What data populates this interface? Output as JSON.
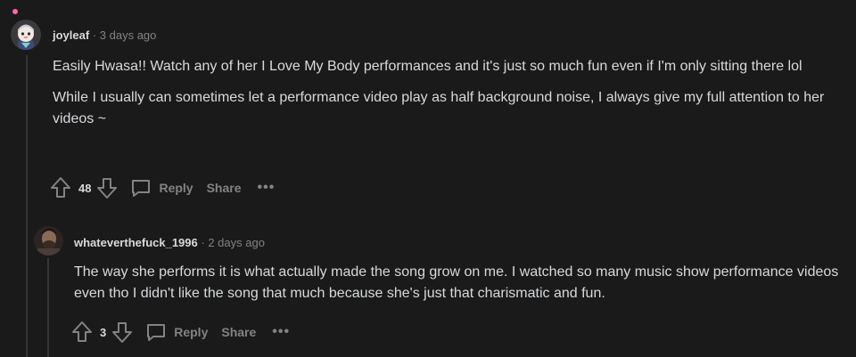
{
  "comments": [
    {
      "username": "joyleaf",
      "separator": "·",
      "time": "3 days ago",
      "paragraphs": [
        "Easily Hwasa!! Watch any of her I Love My Body performances and it's just so much fun even if I'm only sitting there lol",
        "While I usually can sometimes let a performance video play as half background noise, I always give my full attention to her videos ~"
      ],
      "votes": "48",
      "reply_label": "Reply",
      "share_label": "Share",
      "more_label": "•••",
      "avatar_icon": "snoo-avatar-icon"
    },
    {
      "username": "whateverthefuck_1996",
      "separator": "·",
      "time": "2 days ago",
      "paragraphs": [
        "The way she performs it is what actually made the song grow on me. I watched so many music show performance videos even tho I didn't like the song that much because she's just that charismatic and fun."
      ],
      "votes": "3",
      "reply_label": "Reply",
      "share_label": "Share",
      "more_label": "•••",
      "avatar_icon": "user-photo-avatar"
    }
  ],
  "colors": {
    "background": "#1a1a1b",
    "text": "#d7dadc",
    "muted": "#818384",
    "thread_line": "#343536",
    "online_dot": "#ff66ac"
  }
}
